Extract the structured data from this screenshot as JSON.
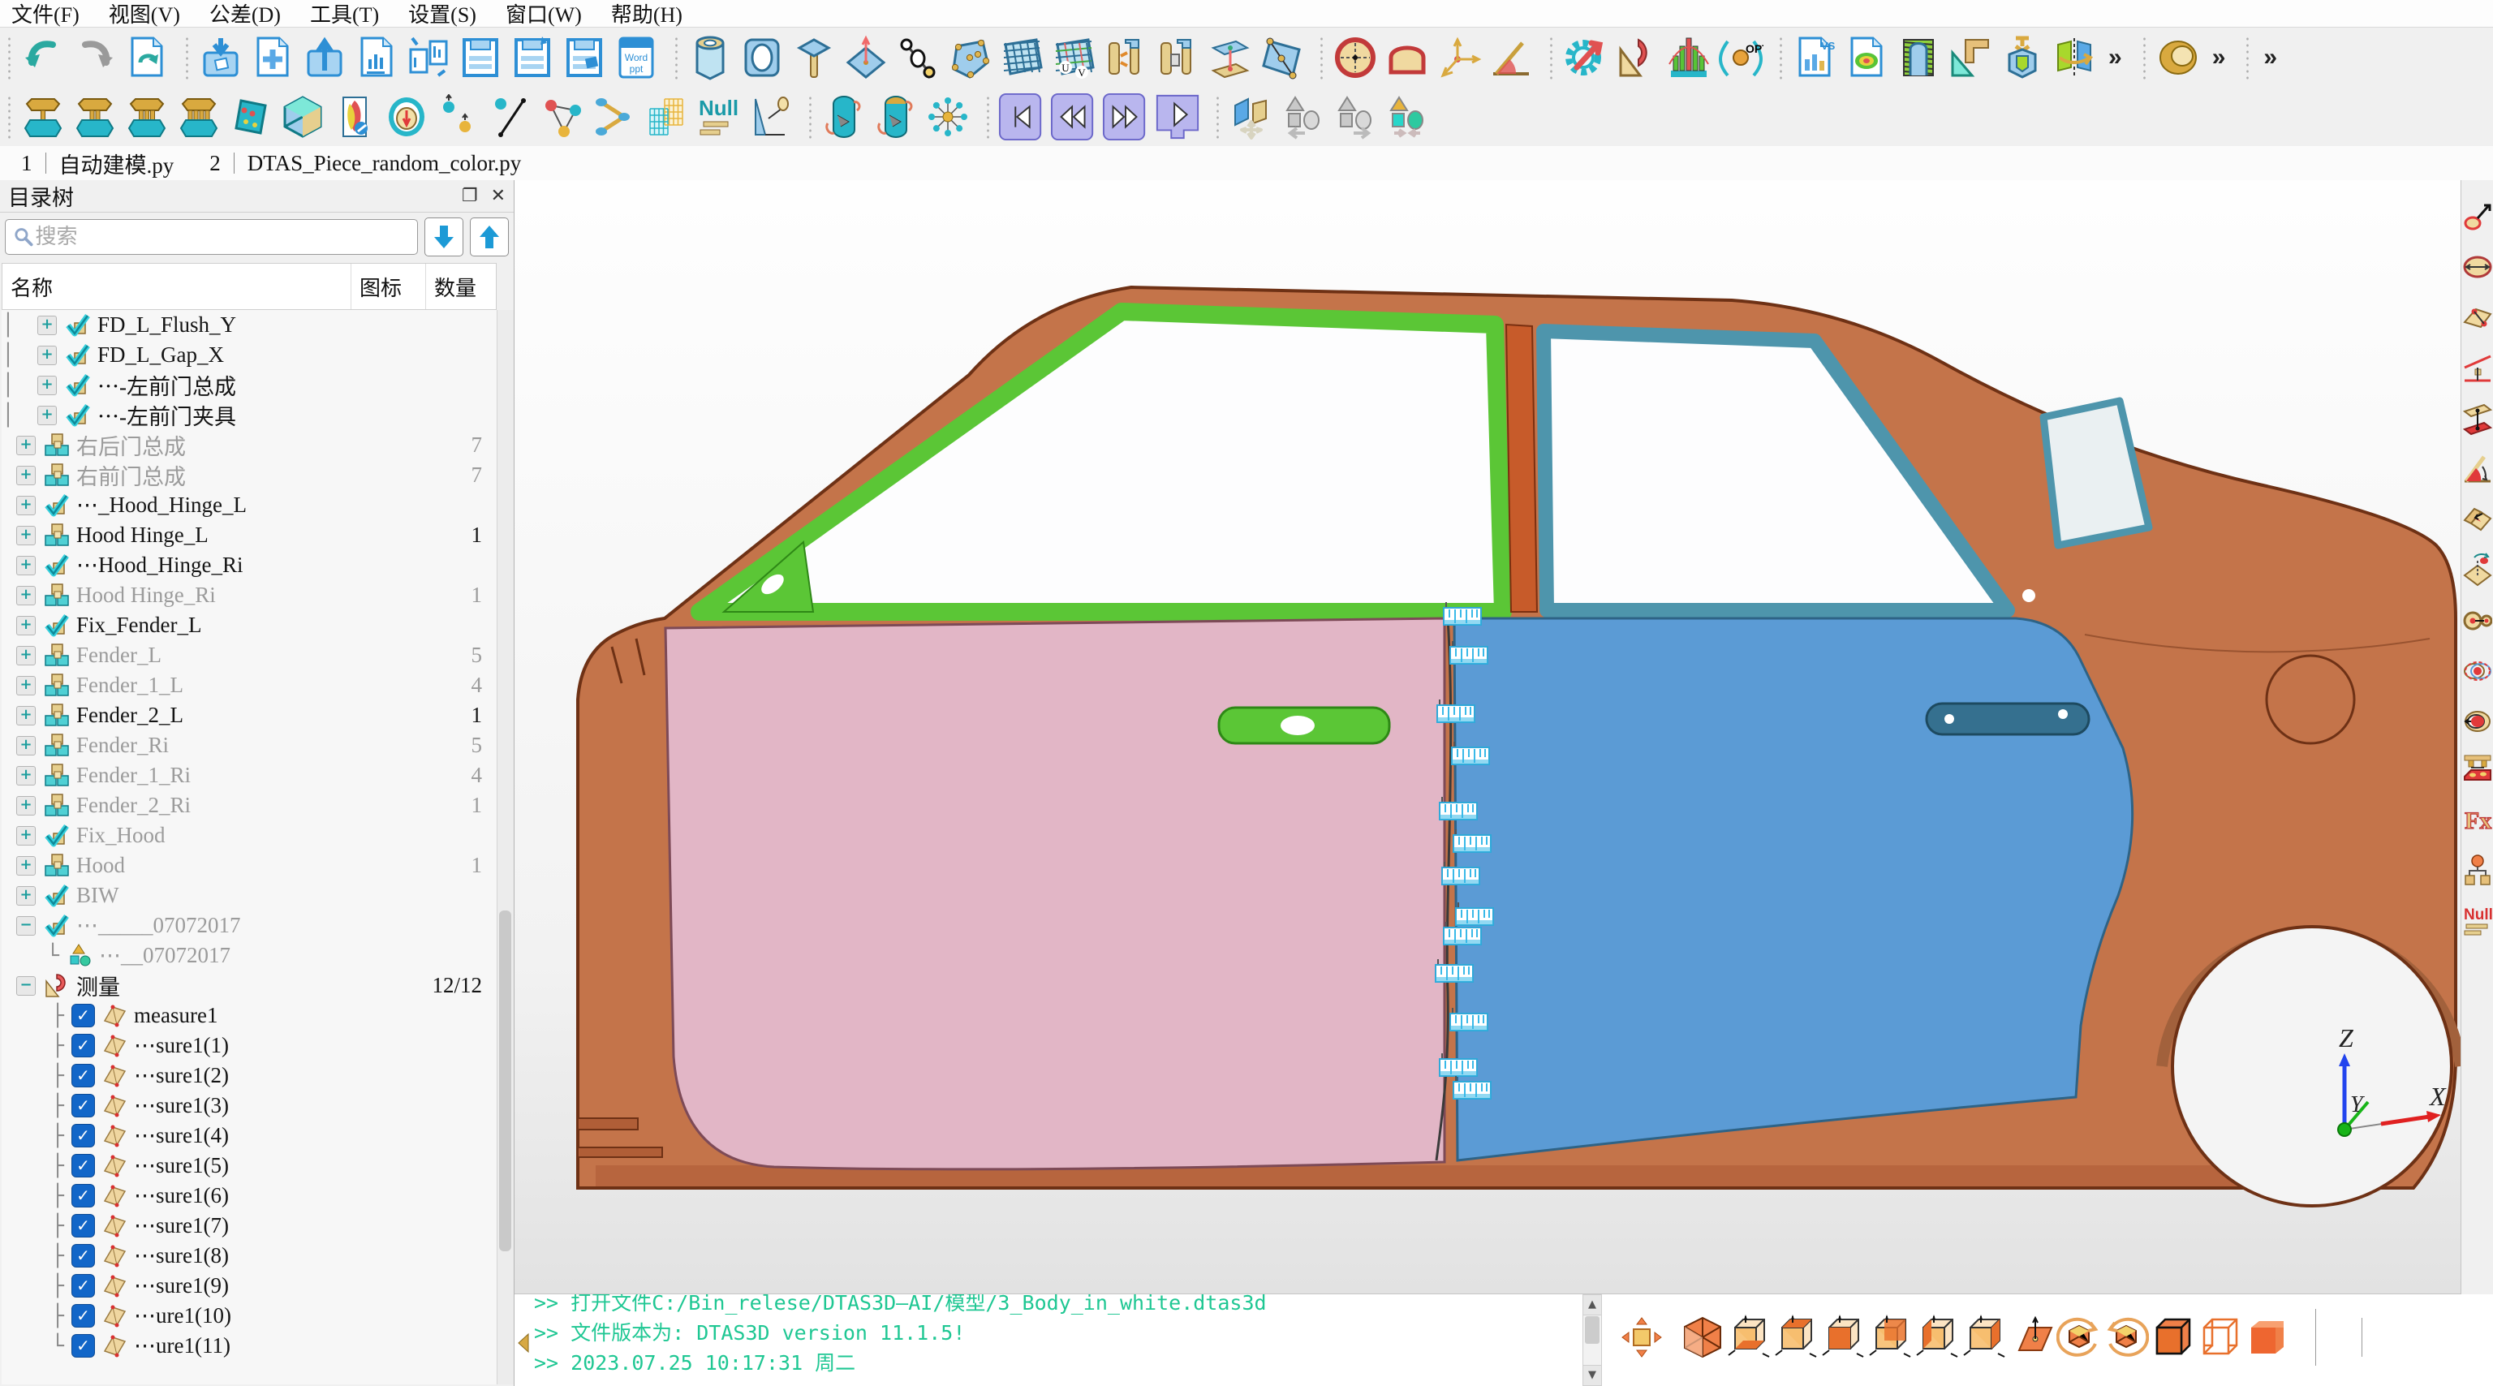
{
  "menu": {
    "items": [
      "文件(F)",
      "视图(V)",
      "公差(D)",
      "工具(T)",
      "设置(S)",
      "窗口(W)",
      "帮助(H)"
    ]
  },
  "toolbar1": {
    "overflow_glyph": "»",
    "groups": [
      {
        "icons": [
          "undo-icon",
          "redo-icon",
          "refresh-doc-icon"
        ]
      },
      {
        "icons": [
          "import-box-icon",
          "new-doc-icon",
          "export-box-icon",
          "report-doc-icon",
          "doc-exchange-icon",
          "save-icon",
          "save-as-icon",
          "save-model-icon",
          "word-ppt-icon"
        ]
      },
      {
        "icons": [
          "cylinder-icon",
          "slot-icon",
          "pin-icon",
          "point-normal-icon",
          "two-point-icon",
          "surface-points-icon",
          "mesh-surface-icon",
          "uv-surface-icon",
          "pin-swap-icon",
          "pin-block-icon",
          "plane-pair-icon",
          "quad-edge-icon"
        ]
      },
      {
        "icons": [
          "circle-feature-icon",
          "arch-feature-icon",
          "axis-triad-icon",
          "angle-feature-icon"
        ]
      },
      {
        "icons": [
          "gear-wrench-icon",
          "protractor-tool-icon",
          "histogram-icon",
          "optimize-opt-icon"
        ]
      },
      {
        "icons": [
          "vs-report-icon",
          "contour-report-icon",
          "thread-bore-icon",
          "set-square-icon",
          "press-fit-icon",
          "mirror-flip-icon"
        ],
        "overflow": true
      },
      {
        "icons": [
          "torus-icon"
        ],
        "overflow": true
      },
      {
        "icons": [],
        "overflow": true
      }
    ]
  },
  "toolbar2": {
    "groups": [
      {
        "icons": [
          "bolt-1-icon",
          "bolt-2-icon",
          "bolt-3-icon",
          "bolt-4-icon",
          "dice-icon",
          "iso-cube-icon",
          "contour-wrench-icon",
          "gauge-icon",
          "point-pair-icon",
          "point-line-icon",
          "triangle-net-icon",
          "link-net-icon",
          "matrix-cube-icon",
          "null-icon",
          "datum-lamp-icon"
        ]
      },
      {
        "icons": [
          "capsule-rotate-icon",
          "capsule-rotate-gold-icon",
          "star-nodes-icon"
        ]
      },
      {
        "icons": [
          "skip-start-icon",
          "rewind-icon",
          "fast-forward-icon",
          "play-monitor-icon"
        ]
      },
      {
        "icons": [
          "move-planes-icon",
          "shapes-back-icon",
          "shapes-forward-icon",
          "shapes-merge-icon"
        ]
      }
    ]
  },
  "tabs": [
    {
      "num": "1",
      "label": "自动建模.py"
    },
    {
      "num": "2",
      "label": "DTAS_Piece_random_color.py"
    }
  ],
  "sidebar": {
    "title": "目录树",
    "float_glyph": "❐",
    "close_glyph": "✕",
    "search_placeholder": "搜索",
    "columns": {
      "name": "名称",
      "icon": "图标",
      "count": "数量"
    },
    "tree": [
      {
        "label": "FD_L_Flush_Y",
        "color": "black",
        "icon": "corner",
        "lvl": 2,
        "exp": "+"
      },
      {
        "label": "FD_L_Gap_X",
        "color": "black",
        "icon": "corner",
        "lvl": 2,
        "exp": "+"
      },
      {
        "label": "⋯-左前门总成",
        "color": "black",
        "icon": "corner",
        "lvl": 2,
        "exp": "+"
      },
      {
        "label": "⋯-左前门夹具",
        "color": "black",
        "icon": "corner",
        "lvl": 2,
        "exp": "+"
      },
      {
        "label": "右后门总成",
        "color": "gray",
        "icon": "cubes",
        "count": "7",
        "exp": "+"
      },
      {
        "label": "右前门总成",
        "color": "gray",
        "icon": "cubes",
        "count": "7",
        "exp": "+"
      },
      {
        "label": "⋯_Hood_Hinge_L",
        "color": "black",
        "icon": "corner",
        "exp": "+"
      },
      {
        "label": "Hood Hinge_L",
        "color": "black",
        "icon": "cubes",
        "count": "1",
        "exp": "+"
      },
      {
        "label": "⋯Hood_Hinge_Ri",
        "color": "black",
        "icon": "corner",
        "exp": "+"
      },
      {
        "label": "Hood Hinge_Ri",
        "color": "gray",
        "icon": "cubes",
        "count": "1",
        "exp": "+"
      },
      {
        "label": "Fix_Fender_L",
        "color": "black",
        "icon": "corner",
        "exp": "+"
      },
      {
        "label": "Fender_L",
        "color": "gray",
        "icon": "cubes",
        "count": "5",
        "exp": "+"
      },
      {
        "label": "Fender_1_L",
        "color": "gray",
        "icon": "cubes",
        "count": "4",
        "exp": "+"
      },
      {
        "label": "Fender_2_L",
        "color": "black",
        "icon": "cubes",
        "count": "1",
        "exp": "+"
      },
      {
        "label": "Fender_Ri",
        "color": "gray",
        "icon": "cubes",
        "count": "5",
        "exp": "+"
      },
      {
        "label": "Fender_1_Ri",
        "color": "gray",
        "icon": "cubes",
        "count": "4",
        "exp": "+"
      },
      {
        "label": "Fender_2_Ri",
        "color": "gray",
        "icon": "cubes",
        "count": "1",
        "exp": "+"
      },
      {
        "label": "Fix_Hood",
        "color": "gray",
        "icon": "corner",
        "exp": "+"
      },
      {
        "label": "Hood",
        "color": "gray",
        "icon": "cubes",
        "count": "1",
        "exp": "+"
      },
      {
        "label": "BIW",
        "color": "gray",
        "icon": "corner",
        "exp": "+"
      },
      {
        "label": "⋯_____07072017",
        "color": "gray",
        "icon": "corner",
        "exp": "-"
      },
      {
        "label": "⋯__07072017",
        "color": "gray",
        "icon": "shapes",
        "branch": "└"
      },
      {
        "label": "测量",
        "color": "black",
        "icon": "protractor",
        "count": "12/12",
        "exp": "-"
      },
      {
        "label": "measure1",
        "color": "black",
        "icon": "quad",
        "branch": "├",
        "checked": true
      },
      {
        "label": "⋯sure1(1)",
        "color": "black",
        "icon": "quad",
        "branch": "├",
        "checked": true
      },
      {
        "label": "⋯sure1(2)",
        "color": "black",
        "icon": "quad",
        "branch": "├",
        "checked": true
      },
      {
        "label": "⋯sure1(3)",
        "color": "black",
        "icon": "quad",
        "branch": "├",
        "checked": true
      },
      {
        "label": "⋯sure1(4)",
        "color": "black",
        "icon": "quad",
        "branch": "├",
        "checked": true
      },
      {
        "label": "⋯sure1(5)",
        "color": "black",
        "icon": "quad",
        "branch": "├",
        "checked": true
      },
      {
        "label": "⋯sure1(6)",
        "color": "black",
        "icon": "quad",
        "branch": "├",
        "checked": true
      },
      {
        "label": "⋯sure1(7)",
        "color": "black",
        "icon": "quad",
        "branch": "├",
        "checked": true
      },
      {
        "label": "⋯sure1(8)",
        "color": "black",
        "icon": "quad",
        "branch": "├",
        "checked": true
      },
      {
        "label": "⋯sure1(9)",
        "color": "black",
        "icon": "quad",
        "branch": "├",
        "checked": true
      },
      {
        "label": "⋯ure1(10)",
        "color": "black",
        "icon": "quad",
        "branch": "├",
        "checked": true
      },
      {
        "label": "⋯ure1(11)",
        "color": "black",
        "icon": "quad",
        "branch": "└",
        "checked": true
      }
    ]
  },
  "viewport": {
    "triad": {
      "x_label": "X",
      "y_label": "Y",
      "z_label": "Z"
    },
    "marker_count": 13,
    "colors": {
      "body_copper": "#C4744A",
      "body_dark": "#6E3115",
      "body_shade": "#B05E37",
      "frame_green": "#5BC636",
      "frame_green_dark": "#2E8816",
      "frame_teal": "#4E95AC",
      "frame_teal_dark": "#2F6F86",
      "pillar_red": "#C75B2A",
      "door_front_pink": "#E2B6C6",
      "door_front_edge": "#7D4A57",
      "door_rear_blue": "#5B9BD5",
      "door_rear_edge": "#2E6386",
      "glass_white": "#FDFDFE",
      "marker_cyan": "#39B9E8",
      "axis_x_red": "#E02020",
      "axis_y_green": "#18B418",
      "axis_z_blue": "#2244EE"
    }
  },
  "right_dock": {
    "icons": [
      "point-measure-icon",
      "ellipse-measure-icon",
      "plane-points-icon",
      "line-angle-icon",
      "plane-distance-icon",
      "angle-measure-icon",
      "fold-angle-icon",
      "plane-rotate-icon",
      "concentric-icon",
      "position-tolerance-icon",
      "profile-ring-icon",
      "fixture-table-icon",
      "fx-icon",
      "hierarchy-icon",
      "null-red-icon"
    ]
  },
  "console": {
    "lines": [
      ">>  打开文件C:/Bin_relese/DTAS3D—AI/模型/3_Body_in_white.dtas3d",
      ">>  文件版本为: DTAS3D  version  11.1.5!",
      ">>  2023.07.25  10:17:31  周二"
    ],
    "scroll_up_glyph": "▲",
    "scroll_down_glyph": "▼"
  },
  "view_toolbar": {
    "icons": [
      "pan-view-icon",
      "iso-view-icon",
      "view-bottom-icon",
      "view-top-icon",
      "view-front-icon",
      "view-back-icon",
      "view-left-icon",
      "view-right-icon",
      "plane-view-icon",
      "rotate-ccw-icon",
      "rotate-cw-icon",
      "shaded-edges-icon",
      "wireframe-icon",
      "shaded-icon"
    ]
  }
}
